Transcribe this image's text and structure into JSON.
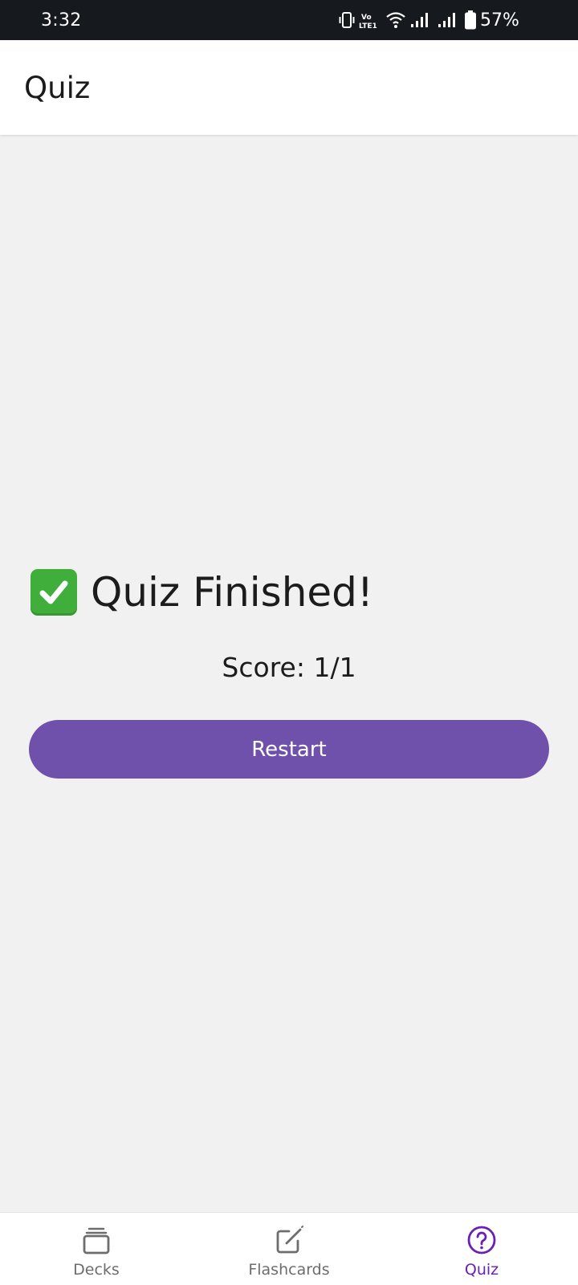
{
  "status_bar": {
    "time": "3:32",
    "battery": "57%",
    "icons": [
      "vibrate-icon",
      "volte-icon",
      "wifi-icon",
      "signal-icon",
      "signal-icon",
      "battery-icon"
    ]
  },
  "header": {
    "title": "Quiz"
  },
  "result": {
    "icon": "check-mark-icon",
    "title": "Quiz Finished!",
    "score": "Score: 1/1",
    "restart_label": "Restart"
  },
  "nav": {
    "items": [
      {
        "label": "Decks",
        "icon": "decks-icon",
        "active": false
      },
      {
        "label": "Flashcards",
        "icon": "edit-icon",
        "active": false
      },
      {
        "label": "Quiz",
        "icon": "question-icon",
        "active": true
      }
    ]
  },
  "colors": {
    "accent": "#6f51ab",
    "active_nav": "#6a1fb8",
    "background": "#f1f1f1",
    "status_bar": "#161a1f",
    "check": "#3fae3b"
  }
}
